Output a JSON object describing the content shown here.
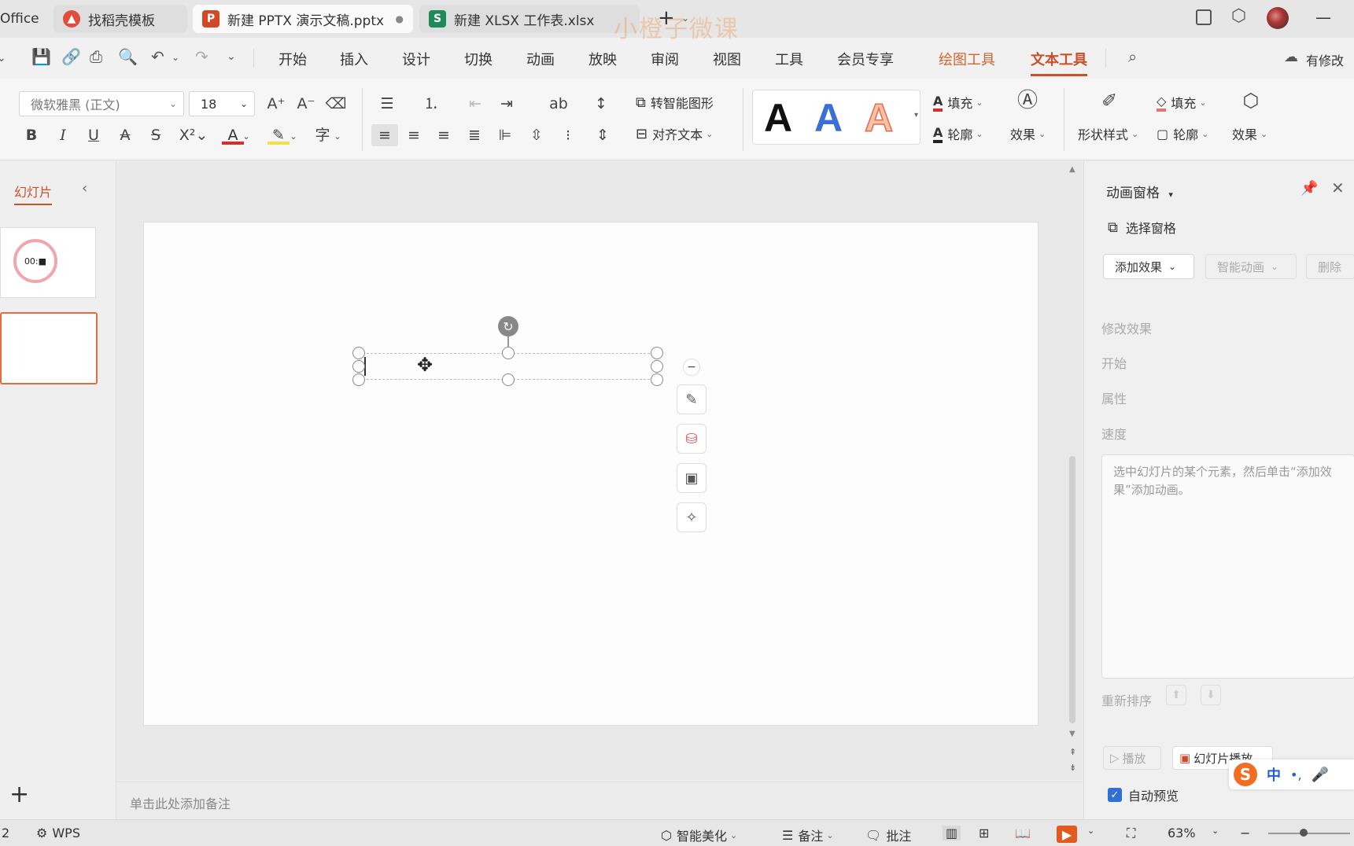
{
  "watermark": "小橙子微课",
  "tabs": [
    {
      "label": "Office"
    },
    {
      "label": "找稻壳模板",
      "icon": "daoke-icon"
    },
    {
      "label": "新建 PPTX 演示文稿.pptx",
      "icon": "P",
      "active": true
    },
    {
      "label": "新建 XLSX 工作表.xlsx",
      "icon": "S"
    }
  ],
  "menu": [
    "开始",
    "插入",
    "设计",
    "切换",
    "动画",
    "放映",
    "审阅",
    "视图",
    "工具",
    "会员专享",
    "绘图工具",
    "文本工具"
  ],
  "menu_right": "有修改",
  "ribbon": {
    "font_name": "微软雅黑 (正文)",
    "font_size": "18",
    "smart_shape": "转智能图形",
    "align_text": "对齐文本",
    "fill": "填充",
    "outline": "轮廓",
    "effect": "效果",
    "shape_style": "形状样式",
    "shape_fill": "填充",
    "shape_outline": "轮廓",
    "shape_effect": "效果"
  },
  "left_panel": {
    "tab_label": "幻灯片",
    "thumb1_text": "00:■"
  },
  "right_panel": {
    "title": "动画窗格",
    "select_pane": "选择窗格",
    "add_effect": "添加效果",
    "smart_anim": "智能动画",
    "delete": "删除",
    "modify_effect": "修改效果",
    "start": "开始",
    "property": "属性",
    "speed": "速度",
    "hint": "选中幻灯片的某个元素，然后单击“添加效果”添加动画。",
    "reorder": "重新排序",
    "play": "播放",
    "slideshow": "幻灯片播放",
    "auto_preview": "自动预览"
  },
  "ime": {
    "lang": "中",
    "punct": "•,"
  },
  "notes_placeholder": "单击此处添加备注",
  "status": {
    "page": "2",
    "wps": "WPS",
    "beautify": "智能美化",
    "notes": "备注",
    "comment": "批注",
    "zoom": "63%"
  },
  "colors": {
    "accent": "#d24726",
    "menu_active": "#c7522a",
    "ppt_icon": "#d24726",
    "xlsx_icon": "#1e8a5a",
    "checkbox": "#2f6fd6"
  }
}
